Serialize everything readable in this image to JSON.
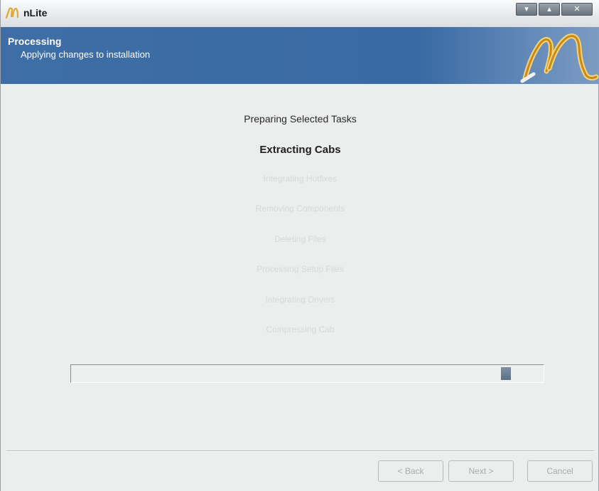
{
  "window": {
    "title": "nLite",
    "controls": {
      "minimize": "▾",
      "maximize": "▴",
      "close": "✕"
    }
  },
  "header": {
    "title": "Processing",
    "subtitle": "Applying changes to installation"
  },
  "tasks": [
    {
      "label": "Preparing Selected Tasks",
      "state": "done"
    },
    {
      "label": "Extracting Cabs",
      "state": "active"
    },
    {
      "label": "Integrating Hotfixes",
      "state": "pending"
    },
    {
      "label": "Removing Components",
      "state": "pending"
    },
    {
      "label": "Deleting Files",
      "state": "pending"
    },
    {
      "label": "Processing Setup Files",
      "state": "pending"
    },
    {
      "label": "Integrating Drivers",
      "state": "pending"
    },
    {
      "label": "Compressing Cab",
      "state": "pending"
    }
  ],
  "progress": {
    "marquee_position": 0.93
  },
  "footer": {
    "back_label": "< Back",
    "next_label": "Next >",
    "cancel_label": "Cancel"
  },
  "colors": {
    "header_blue": "#3f6ea6",
    "logo_gold": "#e0a92a"
  }
}
